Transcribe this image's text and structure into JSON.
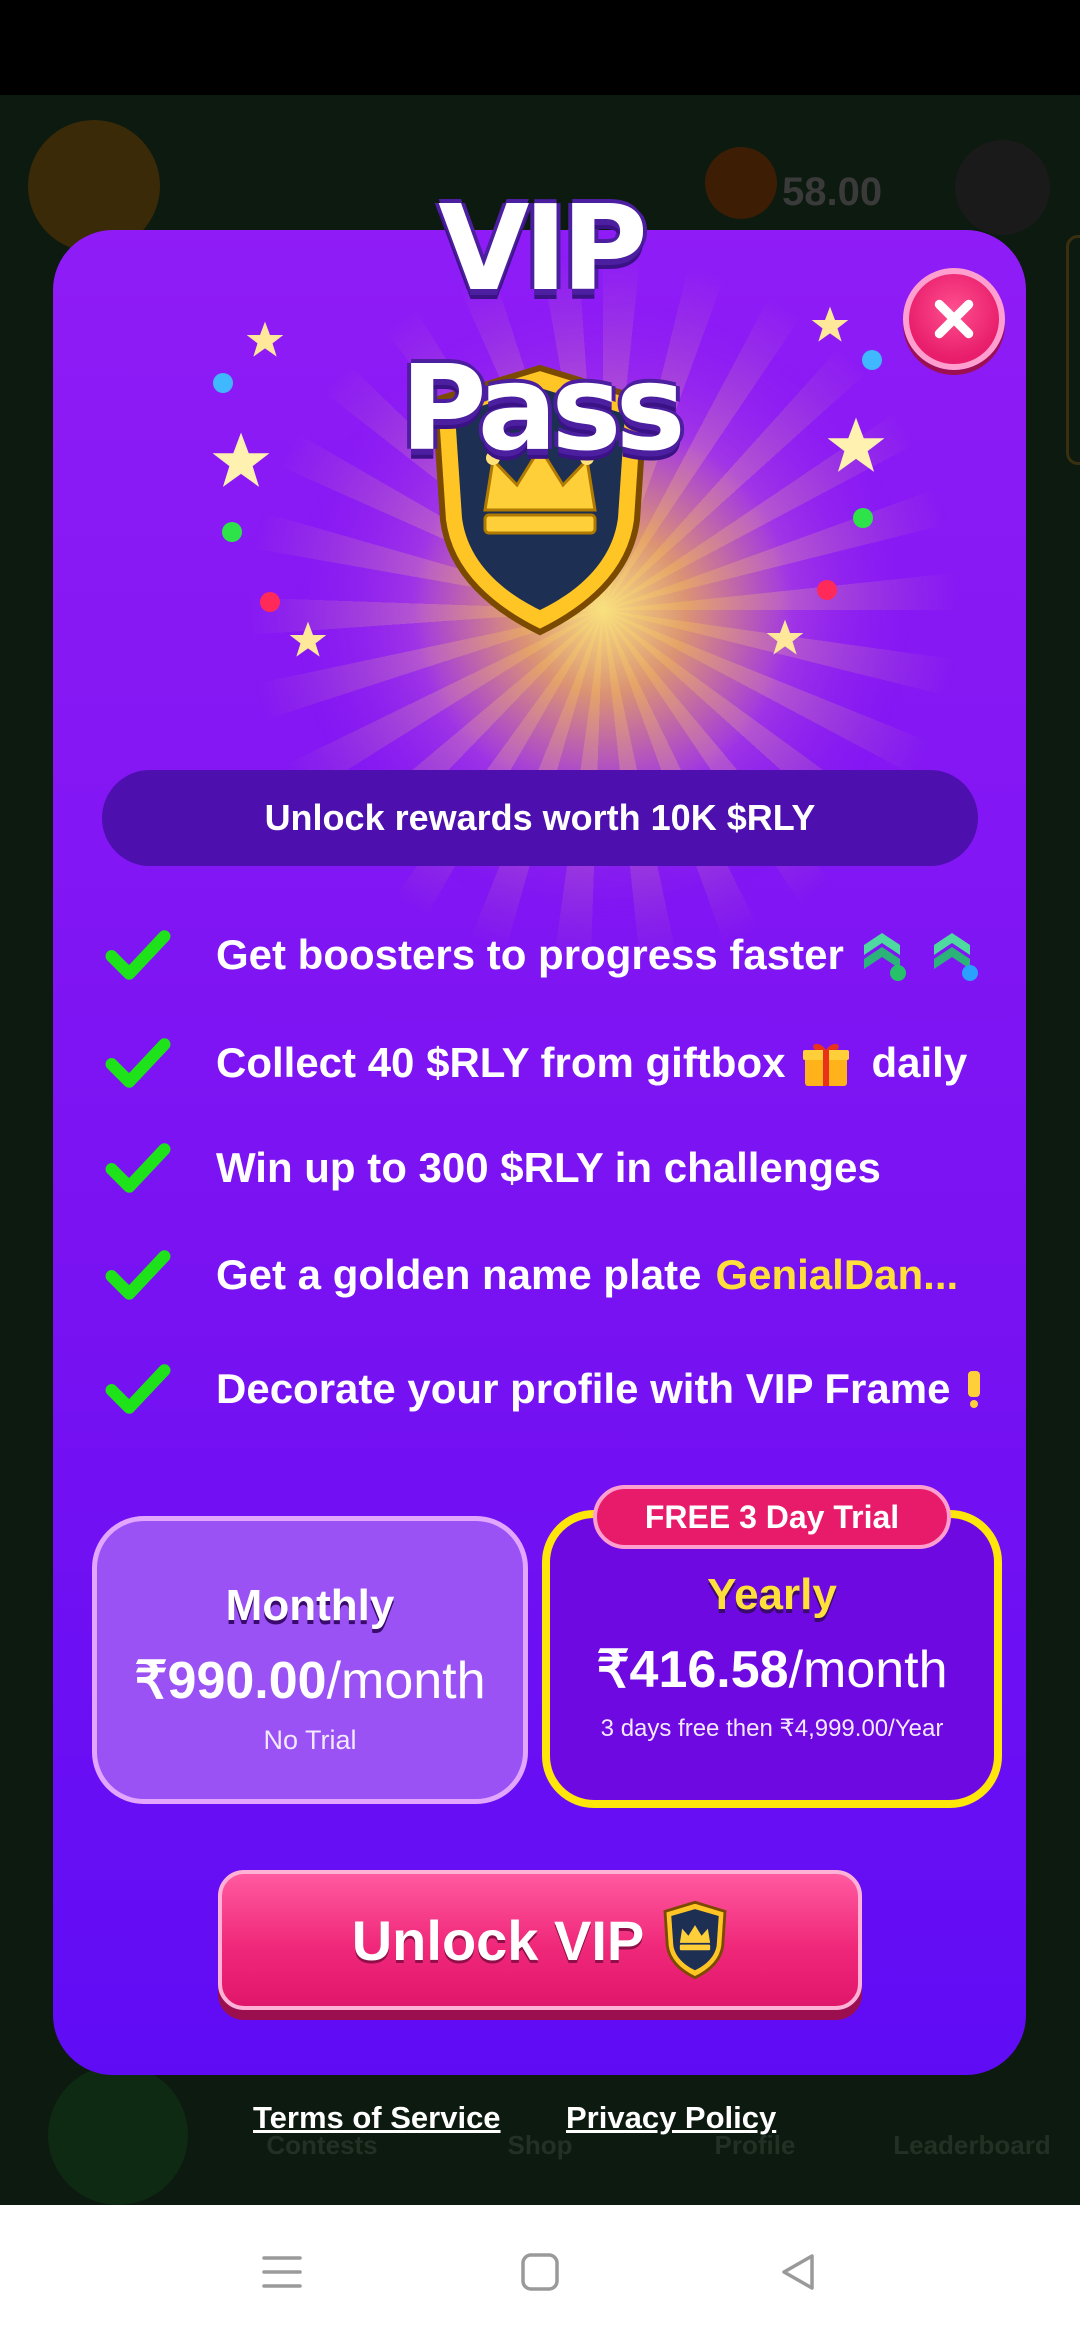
{
  "background": {
    "balance": "58.00",
    "nav_items": [
      "Contests",
      "Shop",
      "Profile",
      "Leaderboard"
    ]
  },
  "modal": {
    "title": "VIP Pass",
    "close_icon": "close-icon",
    "rewards_banner": "Unlock rewards worth 10K $RLY",
    "benefits": [
      {
        "text": "Get boosters to progress faster",
        "icon": "booster-icons"
      },
      {
        "text": "Collect 40 $RLY from giftbox",
        "icon": "gift-icon",
        "suffix": "daily"
      },
      {
        "text": "Win up to 300 $RLY in challenges"
      },
      {
        "text": "Get a golden name plate",
        "highlight": "GenialDan..."
      },
      {
        "text": "Decorate your profile with VIP Frame",
        "icon": "frame-icon"
      }
    ],
    "plans": {
      "monthly": {
        "name": "Monthly",
        "price": "₹990.00",
        "per": "/month",
        "note": "No Trial"
      },
      "yearly": {
        "name": "Yearly",
        "price": "₹416.58",
        "per": "/month",
        "note": "3 days free then ₹4,999.00/Year",
        "badge": "FREE 3 Day Trial",
        "selected": true
      }
    },
    "cta": {
      "label": "Unlock VIP",
      "icon": "vip-shield-icon"
    }
  },
  "legal": {
    "terms": "Terms of Service",
    "privacy": "Privacy Policy"
  },
  "system_nav": {
    "icons": [
      "menu-icon",
      "home-square-icon",
      "back-triangle-icon"
    ]
  },
  "colors": {
    "modal_purple": "#8f1cf6",
    "accent_pink": "#e81b6b",
    "gold": "#ffe03a",
    "check_green": "#1ee31a"
  }
}
